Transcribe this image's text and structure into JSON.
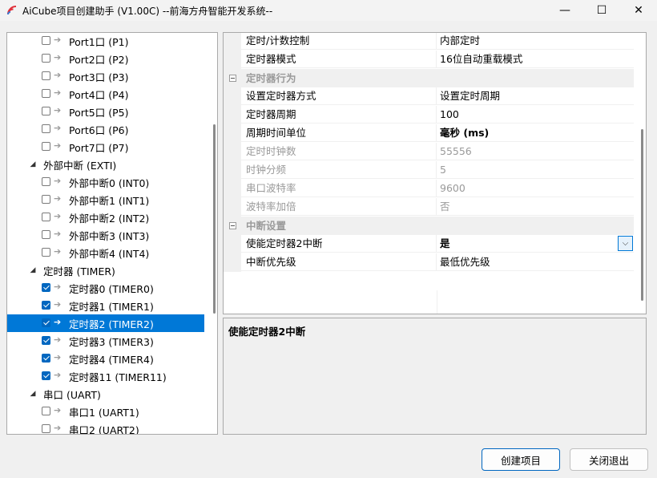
{
  "window": {
    "title": "AiCube项目创建助手 (V1.00C) --前海方舟智能开发系统--",
    "minimize_glyph": "—",
    "maximize_glyph": "☐",
    "close_glyph": "✕"
  },
  "tree": {
    "rows": [
      {
        "label": "Port1口 (P1)",
        "type": "item",
        "checked": false
      },
      {
        "label": "Port2口 (P2)",
        "type": "item",
        "checked": false
      },
      {
        "label": "Port3口 (P3)",
        "type": "item",
        "checked": false
      },
      {
        "label": "Port4口 (P4)",
        "type": "item",
        "checked": false
      },
      {
        "label": "Port5口 (P5)",
        "type": "item",
        "checked": false
      },
      {
        "label": "Port6口 (P6)",
        "type": "item",
        "checked": false
      },
      {
        "label": "Port7口 (P7)",
        "type": "item",
        "checked": false
      },
      {
        "label": "外部中断 (EXTI)",
        "type": "group"
      },
      {
        "label": "外部中断0 (INT0)",
        "type": "item",
        "checked": false
      },
      {
        "label": "外部中断1 (INT1)",
        "type": "item",
        "checked": false
      },
      {
        "label": "外部中断2 (INT2)",
        "type": "item",
        "checked": false
      },
      {
        "label": "外部中断3 (INT3)",
        "type": "item",
        "checked": false
      },
      {
        "label": "外部中断4 (INT4)",
        "type": "item",
        "checked": false
      },
      {
        "label": "定时器 (TIMER)",
        "type": "group"
      },
      {
        "label": "定时器0 (TIMER0)",
        "type": "item",
        "checked": true
      },
      {
        "label": "定时器1 (TIMER1)",
        "type": "item",
        "checked": true
      },
      {
        "label": "定时器2 (TIMER2)",
        "type": "item",
        "checked": true,
        "selected": true
      },
      {
        "label": "定时器3 (TIMER3)",
        "type": "item",
        "checked": true
      },
      {
        "label": "定时器4 (TIMER4)",
        "type": "item",
        "checked": true
      },
      {
        "label": "定时器11 (TIMER11)",
        "type": "item",
        "checked": true
      },
      {
        "label": "串口 (UART)",
        "type": "group"
      },
      {
        "label": "串口1 (UART1)",
        "type": "item",
        "checked": false
      },
      {
        "label": "串口2 (UART2)",
        "type": "item",
        "checked": false
      }
    ]
  },
  "properties": {
    "rows": [
      {
        "kind": "prop",
        "name": "定时/计数控制",
        "value": "内部定时"
      },
      {
        "kind": "prop",
        "name": "定时器模式",
        "value": "16位自动重载模式"
      },
      {
        "kind": "category",
        "name": "定时器行为"
      },
      {
        "kind": "prop",
        "name": "设置定时器方式",
        "value": "设置定时周期"
      },
      {
        "kind": "prop",
        "name": "定时器周期",
        "value": "100"
      },
      {
        "kind": "prop",
        "name": "周期时间单位",
        "value": "毫秒 (ms)",
        "bold": true
      },
      {
        "kind": "prop",
        "name": "定时时钟数",
        "value": "55556",
        "disabled": true
      },
      {
        "kind": "prop",
        "name": "时钟分频",
        "value": "5",
        "disabled": true
      },
      {
        "kind": "prop",
        "name": "串口波特率",
        "value": "9600",
        "disabled": true
      },
      {
        "kind": "prop",
        "name": "波特率加倍",
        "value": "否",
        "disabled": true
      },
      {
        "kind": "category",
        "name": "中断设置"
      },
      {
        "kind": "prop",
        "name": "使能定时器2中断",
        "value": "是",
        "bold": true,
        "dropdown": true
      },
      {
        "kind": "prop",
        "name": "中断优先级",
        "value": "最低优先级"
      }
    ],
    "description_title": "使能定时器2中断"
  },
  "buttons": {
    "create": "创建项目",
    "close": "关闭退出"
  },
  "colors": {
    "selection": "#0078d7",
    "checkbox_checked": "#0067c0",
    "disabled_text": "#9a9a9a"
  },
  "icons": {
    "app": "aicube-logo-icon",
    "tree_item": "arrow-right-icon",
    "expander": "triangle-expanded-icon",
    "category": "minus-box-icon",
    "dropdown": "chevron-down-icon"
  }
}
